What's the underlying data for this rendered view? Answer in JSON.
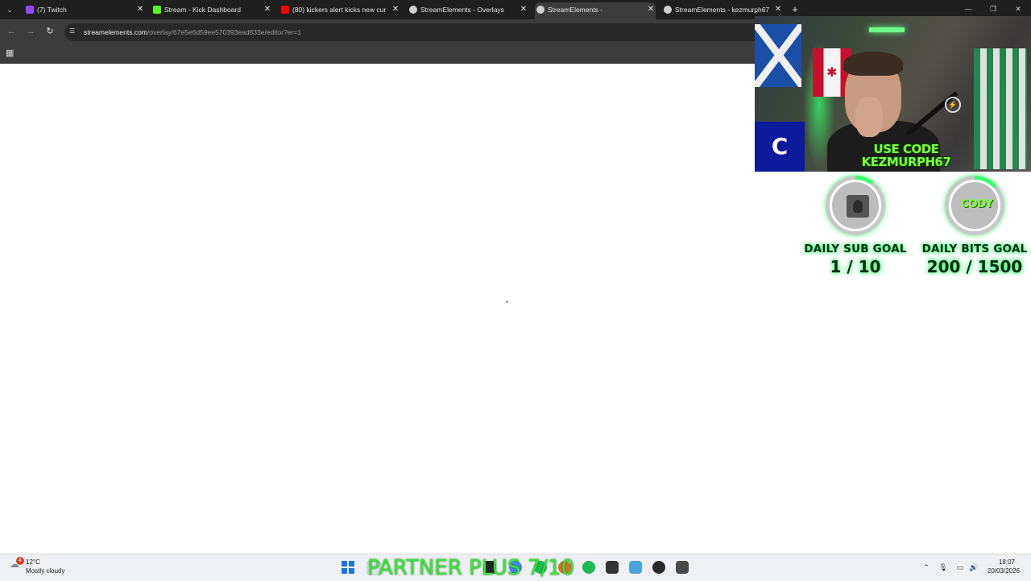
{
  "tabs": [
    {
      "title": "(7) Twitch",
      "favicon_color": "#9146ff"
    },
    {
      "title": "Stream - Kick Dashboard",
      "favicon_color": "#53fc18"
    },
    {
      "title": "(80) kickers alert kicks new cur",
      "favicon_color": "#ff0000"
    },
    {
      "title": "StreamElements - Overlays",
      "favicon_color": "#d0d0d0"
    },
    {
      "title": "StreamElements -",
      "favicon_color": "#d0d0d0",
      "active": true
    },
    {
      "title": "StreamElements - kezmurph67",
      "favicon_color": "#d0d0d0"
    }
  ],
  "address_bar": {
    "url_host": "streamelements.com",
    "url_path": "/overlay/67e5e6d59ee570393ead833e/editor?er=1"
  },
  "overlay": {
    "badge_letter": "C",
    "promo_line1": "USE CODE",
    "promo_line2": "KEZMURPH67",
    "bits_image_text": "CODY",
    "sub_goal": {
      "label": "DAILY SUB GOAL",
      "count": "1 / 10",
      "current": 1,
      "target": 10
    },
    "bits_goal": {
      "label": "DAILY BITS GOAL",
      "count": "200 / 1500",
      "current": 200,
      "target": 1500
    },
    "accent_color": "#3bff6e"
  },
  "taskbar": {
    "weather_badge": "4",
    "weather_temp": "12°C",
    "weather_condition": "Mostly cloudy",
    "banner_text": "PARTNER PLUS 7/10",
    "clock_time": "18:07",
    "clock_date": "20/03/2026"
  }
}
